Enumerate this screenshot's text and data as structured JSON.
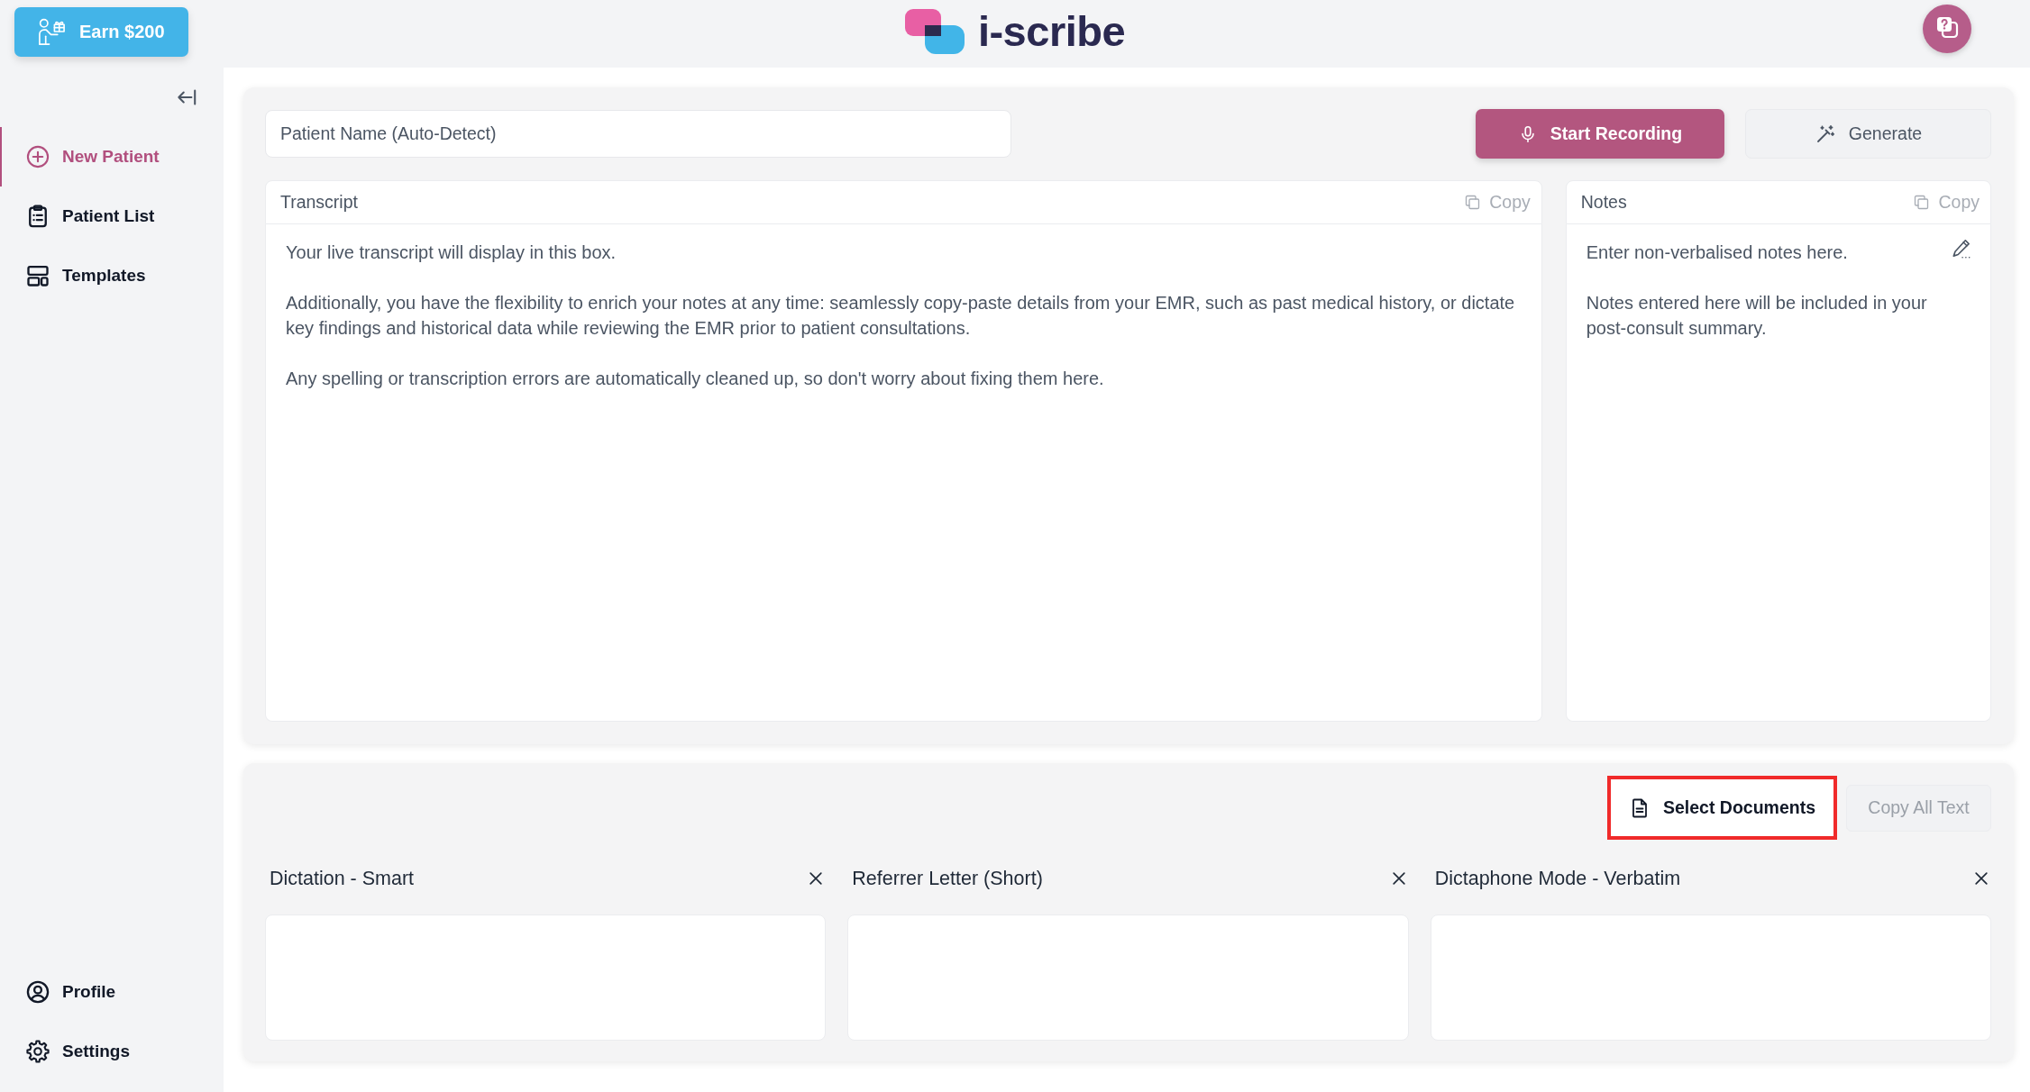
{
  "header": {
    "earn_button": {
      "label": "Earn $200"
    },
    "logo": {
      "text": "i-scribe"
    }
  },
  "sidebar": {
    "items": [
      {
        "label": "New Patient",
        "selected": true
      },
      {
        "label": "Patient List",
        "selected": false
      },
      {
        "label": "Templates",
        "selected": false
      }
    ],
    "bottom_items": [
      {
        "label": "Profile",
        "selected": false
      },
      {
        "label": "Settings",
        "selected": false
      }
    ]
  },
  "session": {
    "patient_name": {
      "placeholder": "Patient Name (Auto-Detect)"
    },
    "buttons": [
      {
        "label": "Start Recording",
        "kind": "primary"
      },
      {
        "label": "Generate",
        "kind": "secondary"
      }
    ],
    "transcript": {
      "title": "Transcript",
      "copy_button": {
        "label": "Copy",
        "disabled": true
      },
      "placeholder": "Your live transcript will display in this box.\n\nAdditionally, you have the flexibility to enrich your notes at any time: seamlessly copy-paste details from your EMR, such as past medical history, or dictate key findings and historical data while reviewing the EMR prior to patient consultations.\n\nAny spelling or transcription errors are automatically cleaned up, so don't worry about fixing them here."
    },
    "notes": {
      "title": "Notes",
      "copy_button": {
        "label": "Copy",
        "disabled": true
      },
      "placeholder": "Enter non-verbalised notes here.\n\nNotes entered here will be included in your post-consult summary."
    }
  },
  "documents": {
    "buttons": [
      {
        "label": "Select Documents",
        "highlighted": true,
        "disabled": false
      },
      {
        "label": "Copy All Text",
        "highlighted": false,
        "disabled": true
      }
    ],
    "templates": [
      {
        "title": "Dictation - Smart"
      },
      {
        "title": "Referrer Letter (Short)"
      },
      {
        "title": "Dictaphone Mode - Verbatim"
      }
    ]
  }
}
